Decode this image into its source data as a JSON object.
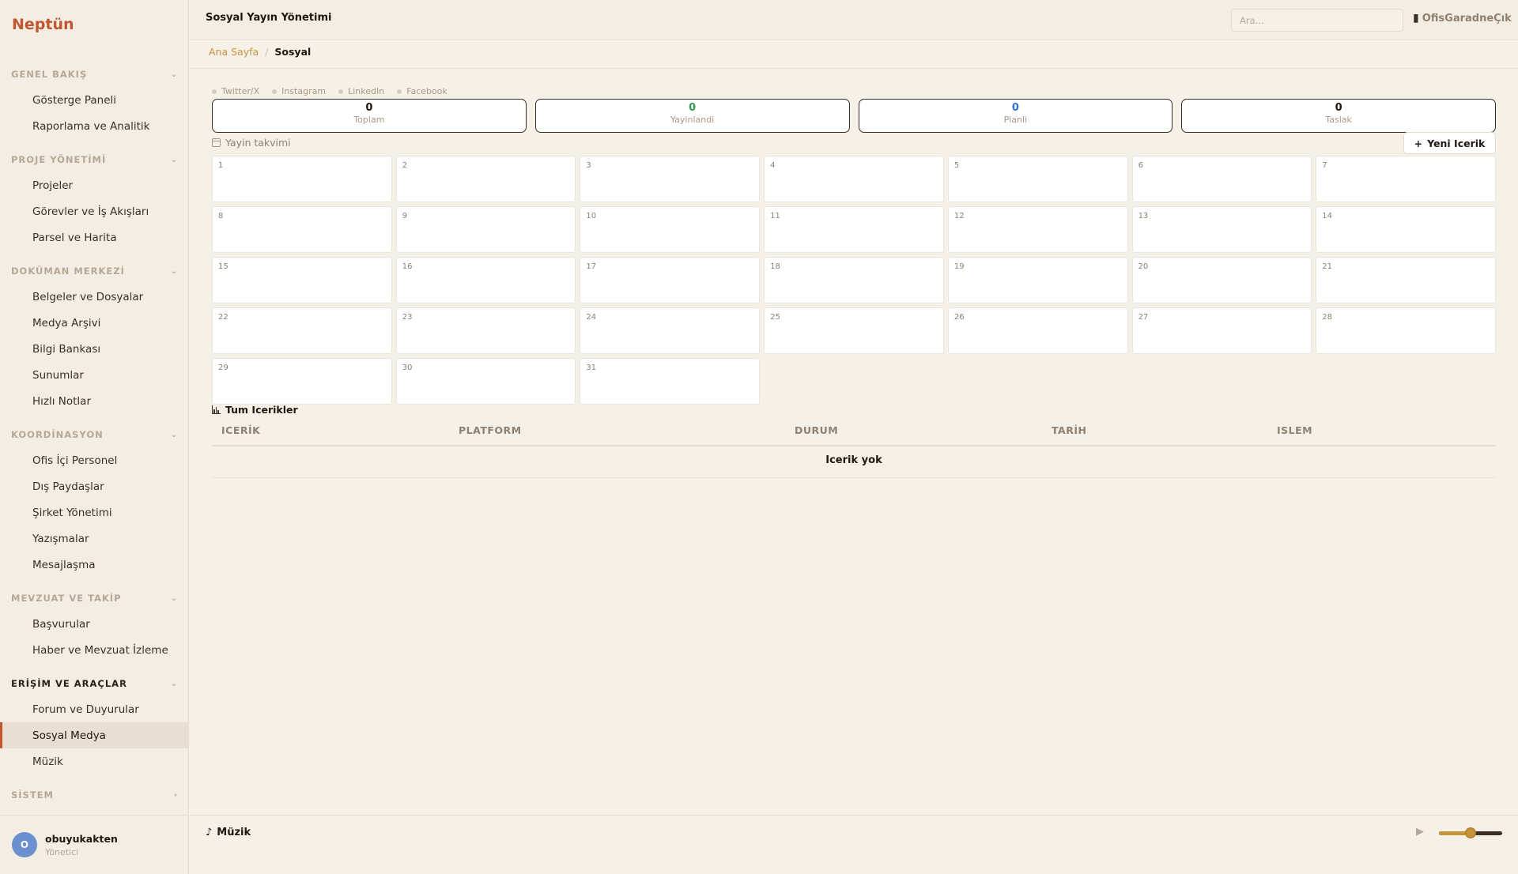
{
  "app": {
    "brand": "Neptün"
  },
  "sidebar": {
    "sections": [
      {
        "title": "GENEL BAKIŞ",
        "expanded": true,
        "active": false,
        "items": [
          "Gösterge Paneli",
          "Raporlama ve Analitik"
        ]
      },
      {
        "title": "PROJE YÖNETİMİ",
        "expanded": true,
        "active": false,
        "items": [
          "Projeler",
          "Görevler ve İş Akışları",
          "Parsel ve Harita"
        ]
      },
      {
        "title": "DOKÜMAN MERKEZİ",
        "expanded": true,
        "active": false,
        "items": [
          "Belgeler ve Dosyalar",
          "Medya Arşivi",
          "Bilgi Bankası",
          "Sunumlar",
          "Hızlı Notlar"
        ]
      },
      {
        "title": "KOORDİNASYON",
        "expanded": true,
        "active": false,
        "items": [
          "Ofis İçi Personel",
          "Dış Paydaşlar",
          "Şirket Yönetimi",
          "Yazışmalar",
          "Mesajlaşma"
        ]
      },
      {
        "title": "MEVZUAT VE TAKİP",
        "expanded": true,
        "active": false,
        "items": [
          "Başvurular",
          "Haber ve Mevzuat İzleme"
        ]
      },
      {
        "title": "ERİŞİM VE ARAÇLAR",
        "expanded": true,
        "active": true,
        "items": [
          "Forum ve Duyurular",
          "Sosyal Medya",
          "Müzik"
        ]
      },
      {
        "title": "SİSTEM",
        "expanded": false,
        "active": false,
        "items": []
      }
    ],
    "selected_item": "Sosyal Medya",
    "user": {
      "initial": "O",
      "name": "obuyukakten",
      "role": "Yönetici"
    }
  },
  "header": {
    "title": "Sosyal Yayın Yönetimi",
    "search_placeholder": "Ara...",
    "office_link": "OfisGaradneÇık"
  },
  "breadcrumb": {
    "home": "Ana Sayfa",
    "separator": "/",
    "current": "Sosyal"
  },
  "platforms": [
    "Twitter/X",
    "Instagram",
    "LinkedIn",
    "Facebook"
  ],
  "stats": [
    {
      "value": "0",
      "label": "Toplam",
      "color": "#1f1710"
    },
    {
      "value": "0",
      "label": "Yayinlandi",
      "color": "#2f9a52"
    },
    {
      "value": "0",
      "label": "Planli",
      "color": "#2f6fd6"
    },
    {
      "value": "0",
      "label": "Taslak",
      "color": "#1f1710"
    }
  ],
  "calendar": {
    "title": "Yayin takvimi",
    "new_button": "Yeni Icerik",
    "new_button_icon": "+",
    "days": [
      "1",
      "2",
      "3",
      "4",
      "5",
      "6",
      "7",
      "8",
      "9",
      "10",
      "11",
      "12",
      "13",
      "14",
      "15",
      "16",
      "17",
      "18",
      "19",
      "20",
      "21",
      "22",
      "23",
      "24",
      "25",
      "26",
      "27",
      "28",
      "29",
      "30",
      "31"
    ]
  },
  "content_table": {
    "title": "Tum Icerikler",
    "columns": [
      "ICERİK",
      "PLATFORM",
      "DURUM",
      "TARİH",
      "ISLEM"
    ],
    "empty_text": "Icerik yok"
  },
  "music": {
    "label": "Müzik",
    "note_icon": "♪",
    "play_icon": "▶",
    "volume": 0.5
  },
  "colors": {
    "accent": "#c1552e",
    "gold": "#c9953c",
    "background": "#f6f1e8"
  }
}
